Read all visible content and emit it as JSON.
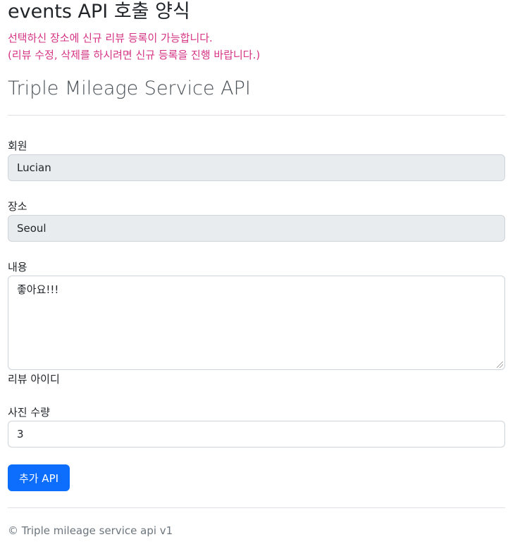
{
  "header": {
    "title": "events API 호출 양식",
    "notice_line1": "선택하신 장소에 신규 리뷰 등록이 가능합니다.",
    "notice_line2": "(리뷰 수정, 삭제를 하시려면 신규 등록을 진행 바랍니다.)"
  },
  "section": {
    "title": "Triple Mileage Service API"
  },
  "form": {
    "user_label": "회원",
    "user_value": "Lucian",
    "place_label": "장소",
    "place_value": "Seoul",
    "content_label": "내용",
    "content_value": "좋아요!!!",
    "review_id_label": "리뷰 아이디",
    "photo_count_label": "사진 수량",
    "photo_count_value": "3",
    "submit_label": "추가 API"
  },
  "footer": {
    "text": "© Triple mileage service api v1"
  },
  "colors": {
    "primary": "#0d6efd",
    "notice": "#d63384",
    "readonly_bg": "#e9ecef"
  }
}
